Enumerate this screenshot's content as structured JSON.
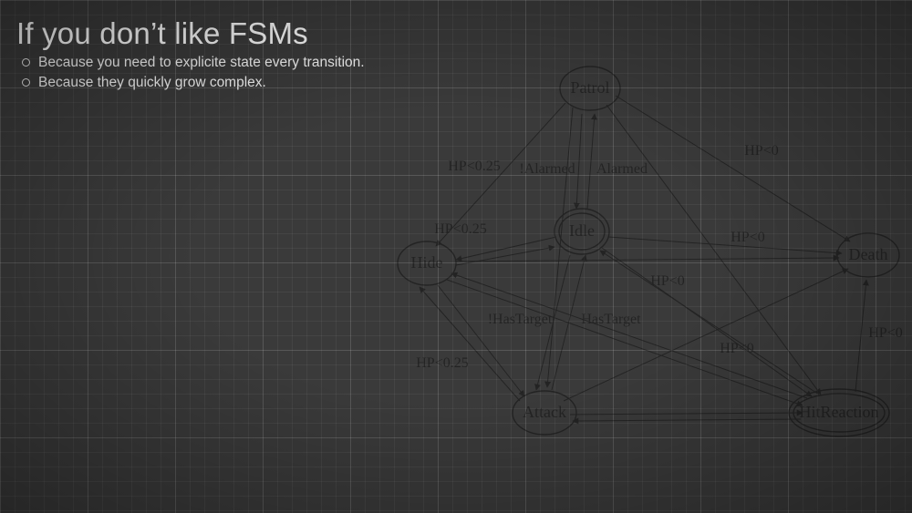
{
  "title": "If you don’t like FSMs",
  "bullets": {
    "items": [
      {
        "text": "Because you need to explicite state every transition."
      },
      {
        "text": "Because they quickly grow complex."
      }
    ]
  },
  "diagram": {
    "type": "fsm",
    "nodes": {
      "patrol": {
        "label": "Patrol",
        "initial": false
      },
      "idle": {
        "label": "Idle",
        "initial": true
      },
      "hide": {
        "label": "Hide",
        "initial": false
      },
      "attack": {
        "label": "Attack",
        "initial": false
      },
      "hitreaction": {
        "label": "HitReaction",
        "initial": true
      },
      "death": {
        "label": "Death",
        "initial": false
      }
    },
    "edges": {
      "patrol_hide": {
        "label": "HP<0.25"
      },
      "patrol_idle_out": {
        "label": "!Alarmed"
      },
      "idle_patrol": {
        "label": "Alarmed"
      },
      "patrol_death": {
        "label": "HP<0"
      },
      "idle_hide": {
        "label": "HP<0.25"
      },
      "idle_attack_out": {
        "label": "!HasTarget"
      },
      "attack_idle": {
        "label": "HasTarget"
      },
      "idle_death": {
        "label": "HP<0"
      },
      "idle_hit": {
        "label": "HP<0"
      },
      "attack_hide": {
        "label": "HP<0.25"
      },
      "attack_hit": {
        "label": "HP<0"
      },
      "attack_death": {
        "label": "HP<0"
      },
      "hit_death": {
        "label": "HP<0"
      }
    }
  }
}
